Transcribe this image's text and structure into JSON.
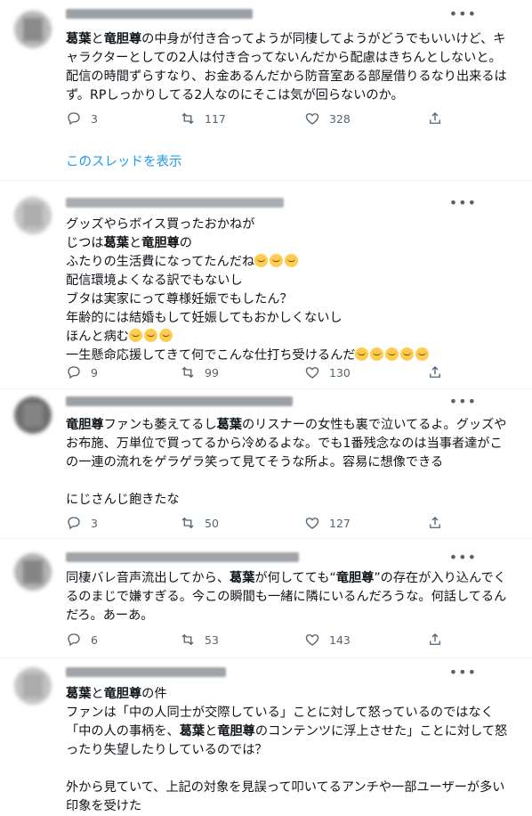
{
  "more_icon": "•••",
  "tweets": [
    {
      "body_parts": [
        {
          "b": true,
          "t": "葛葉"
        },
        {
          "t": "と"
        },
        {
          "b": true,
          "t": "竜胆尊"
        },
        {
          "t": "の中身が付き合ってようが同棲してようがどうでもいいけど、キャラクターとしての2人は付き合ってないんだから配慮はきちんとしないと。配信の時間ずらすなり、お金あるんだから防音室ある部屋借りるなり出来るはず。RPしっかりしてる2人なのにそこは気が回らないのか。"
        }
      ],
      "counts": {
        "reply": "3",
        "retweet": "117",
        "like": "328"
      },
      "thread_link": "このスレッドを表示"
    },
    {
      "body_parts": [
        {
          "t": "グッズやらボイス買ったおかねが\nじつは"
        },
        {
          "b": true,
          "t": "葛葉"
        },
        {
          "t": "と"
        },
        {
          "b": true,
          "t": "竜胆尊"
        },
        {
          "t": "の\nふたりの生活費になってたんだね"
        },
        {
          "e": 3
        },
        {
          "t": "\n配信環境よくなる訳でもないし\nブタは実家にって尊様妊娠でもしたん？\n年齢的には結婚もして妊娠してもおかしくないし\nほんと病む"
        },
        {
          "e": 3
        },
        {
          "t": "\n一生懸命応援してきて何でこんな仕打ち受けるんだ"
        },
        {
          "e": 5
        }
      ],
      "counts": {
        "reply": "9",
        "retweet": "99",
        "like": "130"
      }
    },
    {
      "body_parts": [
        {
          "b": true,
          "t": "竜胆尊"
        },
        {
          "t": "ファンも萎えてるし"
        },
        {
          "b": true,
          "t": "葛葉"
        },
        {
          "t": "のリスナーの女性も裏で泣いてるよ。グッズやお布施、万単位で買ってるから冷めるよな。でも1番残念なのは当事者達がこの一連の流れをゲラゲラ笑って見てそうな所よ。容易に想像できる\n\nにじさんじ飽きたな"
        }
      ],
      "counts": {
        "reply": "3",
        "retweet": "50",
        "like": "127"
      }
    },
    {
      "body_parts": [
        {
          "t": "同棲バレ音声流出してから、"
        },
        {
          "b": true,
          "t": "葛葉"
        },
        {
          "t": "が何してても“"
        },
        {
          "b": true,
          "t": "竜胆尊"
        },
        {
          "t": "”の存在が入り込んでくるのまじで嫌すぎる。今この瞬間も一緒に隣にいるんだろうな。何話してるんだろ。あーあ。"
        }
      ],
      "counts": {
        "reply": "6",
        "retweet": "53",
        "like": "143"
      }
    },
    {
      "body_parts": [
        {
          "b": true,
          "t": "葛葉"
        },
        {
          "t": "と"
        },
        {
          "b": true,
          "t": "竜胆尊"
        },
        {
          "t": "の件\nファンは「中の人同士が交際している」ことに対して怒っているのではなく「中の人の事柄を、"
        },
        {
          "b": true,
          "t": "葛葉"
        },
        {
          "t": "と"
        },
        {
          "b": true,
          "t": "竜胆尊"
        },
        {
          "t": "のコンテンツに浮上させた」ことに対して怒ったり失望したりしているのでは？\n\n外から見ていて、上記の対象を見誤って叩いてるアンチや一部ユーザーが多い印象を受けた"
        }
      ]
    }
  ]
}
